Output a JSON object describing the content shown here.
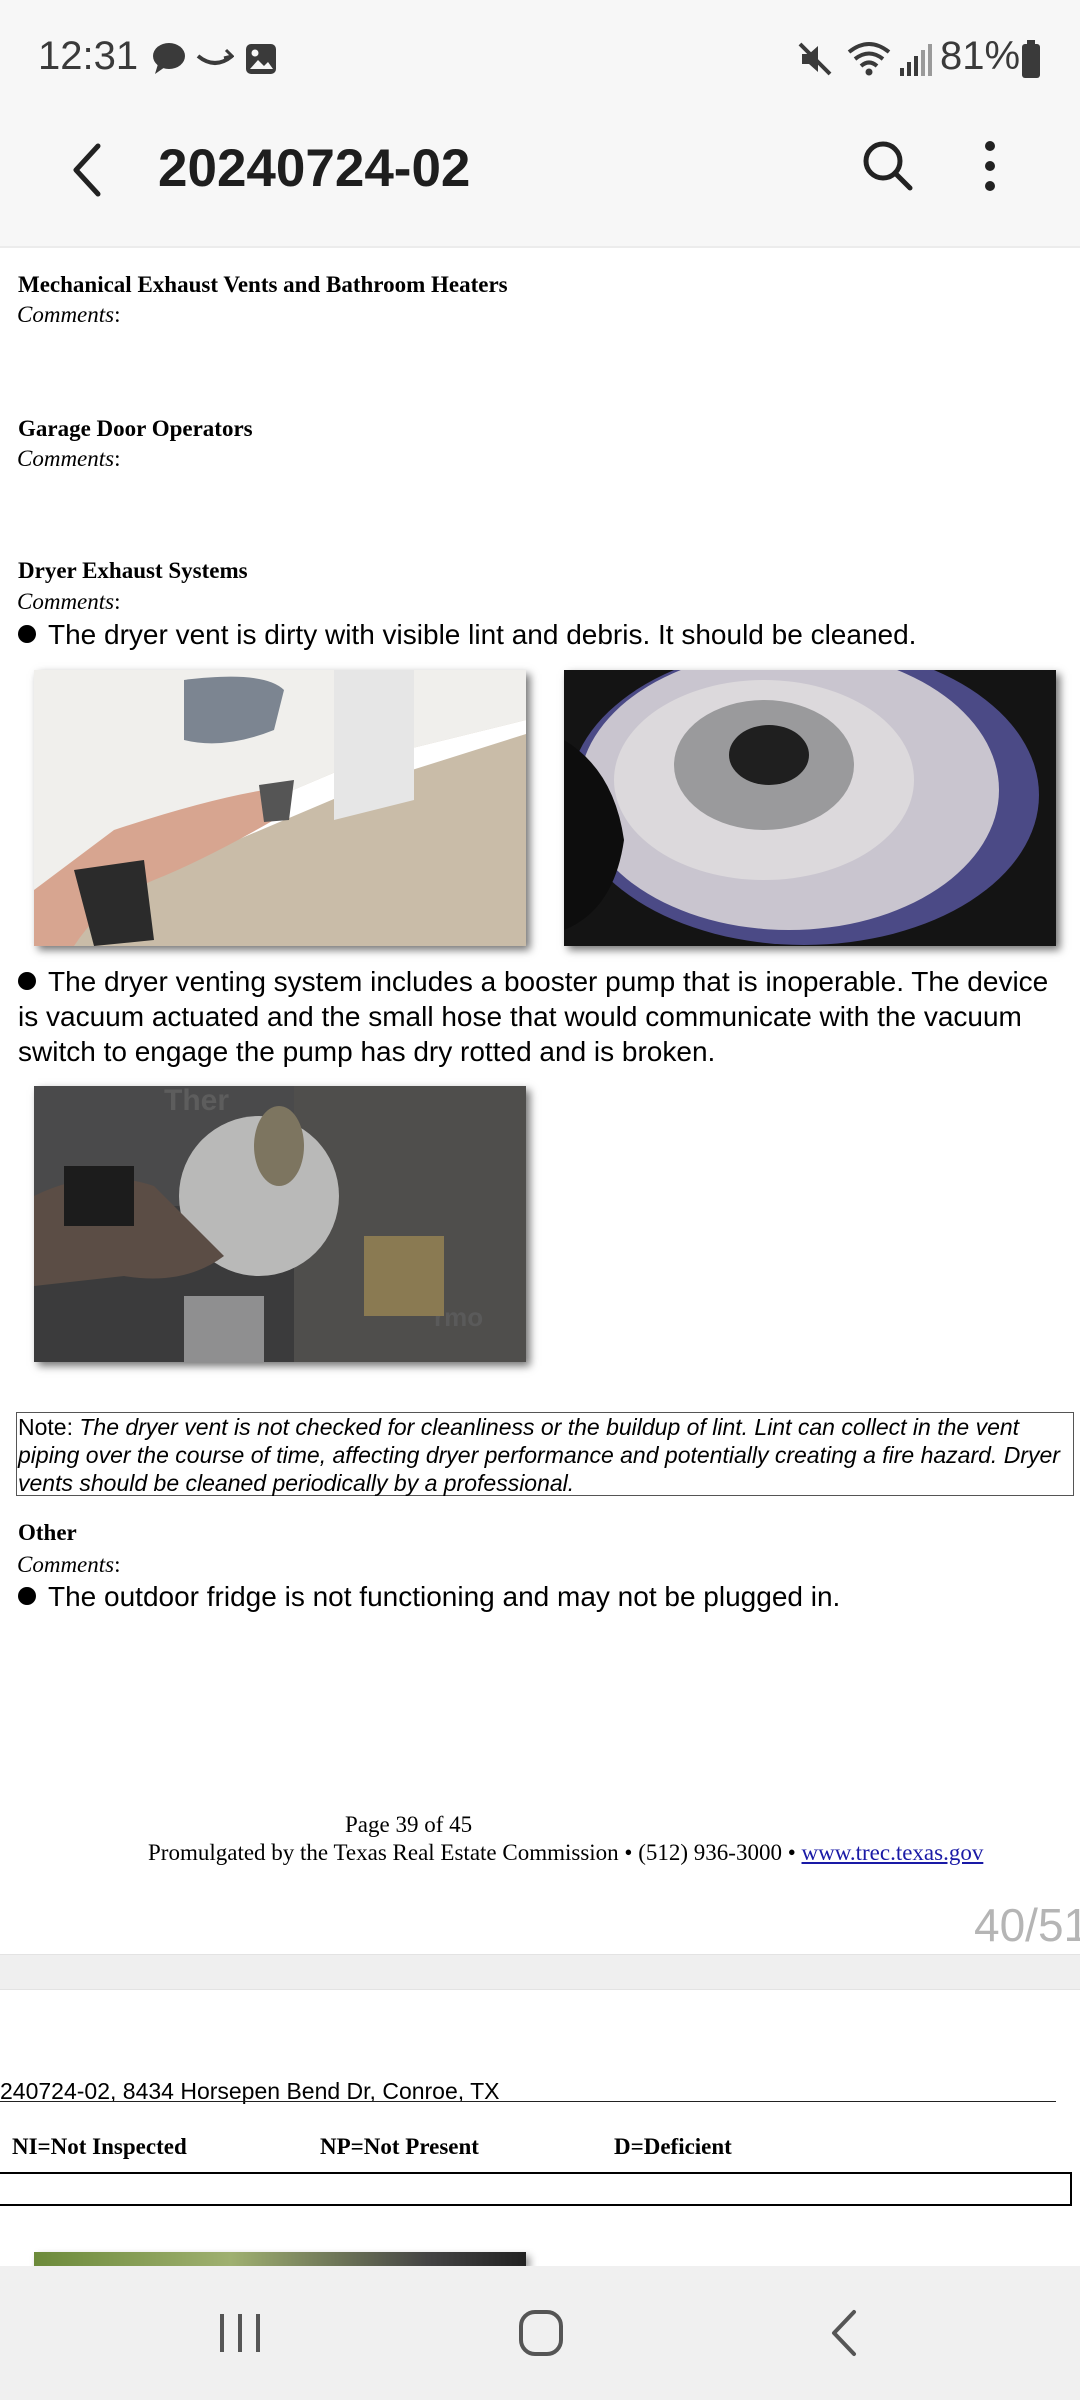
{
  "status_bar": {
    "time": "12:31",
    "battery": "81%",
    "icons": [
      "chat-bubble-icon",
      "smile-icon",
      "image-icon",
      "mute-icon",
      "wifi-icon",
      "signal-icon",
      "battery-icon"
    ]
  },
  "app_bar": {
    "title": "20240724-02",
    "back_icon": "chevron-left-icon",
    "search_icon": "search-icon",
    "more_icon": "more-vert-icon"
  },
  "document": {
    "sections": [
      {
        "heading": "Mechanical Exhaust Vents and Bathroom Heaters",
        "comments_label": "Comments",
        "colon": ":"
      },
      {
        "heading": "Garage Door Operators",
        "comments_label": "Comments",
        "colon": ":"
      },
      {
        "heading": "Dryer Exhaust Systems",
        "comments_label": "Comments",
        "colon": ":"
      },
      {
        "heading": "Other",
        "comments_label": "Comments",
        "colon": ":"
      }
    ],
    "dryer_bullets": [
      "The dryer vent is dirty with visible lint and debris.  It should be cleaned.",
      "The dryer venting system includes a booster pump that is inoperable.  The device is vacuum actuated and the small hose that would communicate with the vacuum switch to engage the pump has dry rotted and is broken."
    ],
    "note_label": "Note:",
    "note_text": "The dryer vent is not checked for cleanliness or the buildup of lint.  Lint can collect in the vent piping over the course of time, affecting dryer performance and potentially creating a fire hazard.  Dryer vents should be cleaned periodically by a professional.",
    "other_bullet": "The outdoor fridge is not functioning and may not be plugged in.",
    "photo_text": "Ther",
    "photo_text_2": "rmo",
    "footer": {
      "page": "Page 39 of 45",
      "promulgated": "Promulgated by the Texas Real Estate Commission • (512) 936-3000 •",
      "link": "www.trec.texas.gov"
    },
    "page_counter": "40/51",
    "next_page": {
      "address": "240724-02, 8434 Horsepen Bend Dr, Conroe, TX",
      "legend": [
        "NI=Not Inspected",
        "NP=Not Present",
        "D=Deficient"
      ]
    }
  },
  "nav_bar": {
    "recents_icon": "recents-icon",
    "home_icon": "home-icon",
    "back_icon": "back-icon"
  }
}
